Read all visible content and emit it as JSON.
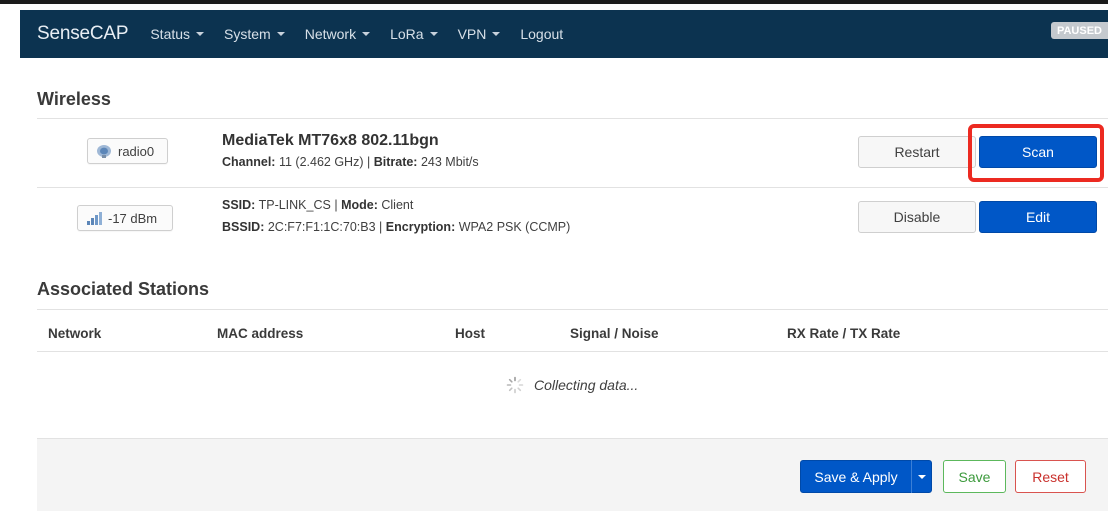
{
  "navbar": {
    "brand": "SenseCAP",
    "menu": [
      {
        "label": "Status"
      },
      {
        "label": "System"
      },
      {
        "label": "Network"
      },
      {
        "label": "LoRa"
      },
      {
        "label": "VPN"
      },
      {
        "label": "Logout"
      }
    ],
    "status_badge": "PAUSED"
  },
  "wireless": {
    "title": "Wireless",
    "device": {
      "badge": "radio0",
      "name": "MediaTek MT76x8 802.11bgn",
      "channel_label": "Channel:",
      "channel_value": "11 (2.462 GHz)",
      "separator": "|",
      "bitrate_label": "Bitrate:",
      "bitrate_value": "243 Mbit/s",
      "restart_label": "Restart",
      "scan_label": "Scan"
    },
    "network": {
      "badge": "-17 dBm",
      "ssid_label": "SSID:",
      "ssid_value": "TP-LINK_CS",
      "separator": "|",
      "mode_label": "Mode:",
      "mode_value": "Client",
      "bssid_label": "BSSID:",
      "bssid_value": "2C:F7:F1:1C:70:B3",
      "encryption_label": "Encryption:",
      "encryption_value": "WPA2 PSK (CCMP)",
      "disable_label": "Disable",
      "edit_label": "Edit"
    }
  },
  "stations": {
    "title": "Associated Stations",
    "columns": [
      "Network",
      "MAC address",
      "Host",
      "Signal / Noise",
      "RX Rate / TX Rate"
    ],
    "loading_text": "Collecting data..."
  },
  "footer": {
    "save_apply_label": "Save & Apply",
    "save_label": "Save",
    "reset_label": "Reset"
  },
  "colors": {
    "navbar_bg": "#0c3350",
    "primary": "#0057c7",
    "highlight": "#ec2a21",
    "save": "#5cb85c",
    "reset": "#d9534f"
  }
}
